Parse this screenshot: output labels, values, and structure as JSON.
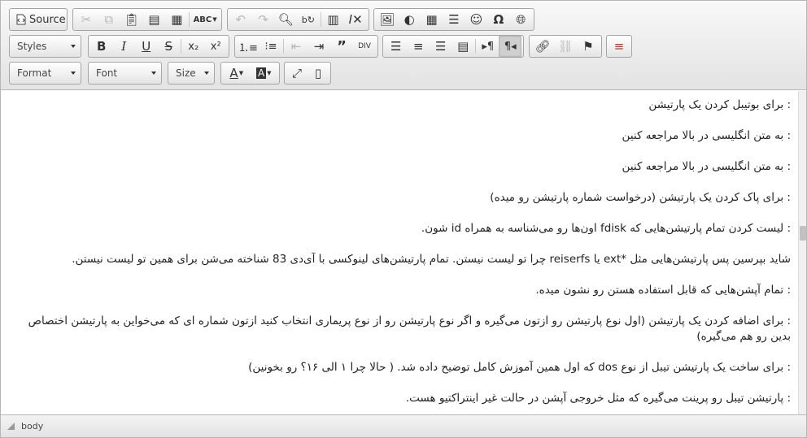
{
  "toolbar": {
    "source_label": "Source",
    "styles_label": "Styles",
    "format_label": "Format",
    "font_label": "Font",
    "size_label": "Size",
    "icons": {
      "source": "source-icon",
      "cut": "cut-icon",
      "copy": "copy-icon",
      "paste": "paste-icon",
      "paste_text": "paste-text-icon",
      "paste_word": "paste-word-icon",
      "spellcheck": "spellcheck-icon",
      "undo": "undo-icon",
      "redo": "redo-icon",
      "find": "find-icon",
      "replace": "replace-icon",
      "select_all": "select-all-icon",
      "remove_format": "remove-format-icon",
      "image": "image-icon",
      "flash": "flash-icon",
      "table": "table-icon",
      "horizontal_rule": "horizontal-rule-icon",
      "smiley": "smiley-icon",
      "special_char": "special-char-icon",
      "iframe": "globe-icon",
      "bold": "bold-icon",
      "italic": "italic-icon",
      "underline": "underline-icon",
      "strike": "strikethrough-icon",
      "subscript": "subscript-icon",
      "superscript": "superscript-icon",
      "numbered_list": "numbered-list-icon",
      "bulleted_list": "bulleted-list-icon",
      "outdent": "outdent-icon",
      "indent": "indent-icon",
      "blockquote": "blockquote-icon",
      "div": "create-div-icon",
      "align_left": "align-left-icon",
      "align_center": "align-center-icon",
      "align_right": "align-right-icon",
      "justify": "justify-icon",
      "ltr": "text-direction-ltr-icon",
      "rtl": "text-direction-rtl-icon",
      "link": "link-icon",
      "unlink": "unlink-icon",
      "anchor": "anchor-flag-icon",
      "page_break": "page-break-icon",
      "text_color": "text-color-icon",
      "bg_color": "background-color-icon",
      "maximize": "maximize-icon",
      "show_blocks": "show-blocks-icon"
    }
  },
  "content": {
    "paragraphs": [
      ": برای بوتیبل کردن یک پارتیشن",
      ": به متن انگلیسی در بالا مراجعه کنین",
      ": به متن انگلیسی در بالا مراجعه کنین",
      ": برای پاک کردن یک پارتیشن (درخواست شماره پارتیشن رو میده)",
      ": لیست کردن تمام پارتیشن‌هایی که fdisk اون‌ها رو می‌شناسه به همراه id شون.",
      "شاید بپرسین پس پارتیشن‌هایی مثل *ext یا reiserfs چرا تو لیست نیستن. تمام پارتیشن‌های لینوکسی با آی‌دی 83 شناخته می‌شن برای همین تو لیست نیستن.",
      ": تمام آپشن‌هایی که قابل استفاده هستن رو نشون میده.",
      ": برای اضافه کردن یک پارتیشن (اول نوع پارتیشن رو ازتون می‌گیره و اگر نوع پارتیشن رو از نوع پریماری انتخاب کنید ازتون شماره ای که می‌خواین به پارتیشن اختصاص بدین رو هم می‌گیره)",
      ": برای ساخت یک پارتیشن تیبل از نوع dos که اول همین آموزش کامل توضیح داده شد.  ( حالا چرا ۱ الی ۱۶؟ رو بخونین)",
      ": پارتیشن تیبل رو پرینت می‌گیره که مثل خروجی آپشن در حالت غیر اینتراکتیو هست."
    ]
  },
  "statusbar": {
    "path": "body"
  }
}
